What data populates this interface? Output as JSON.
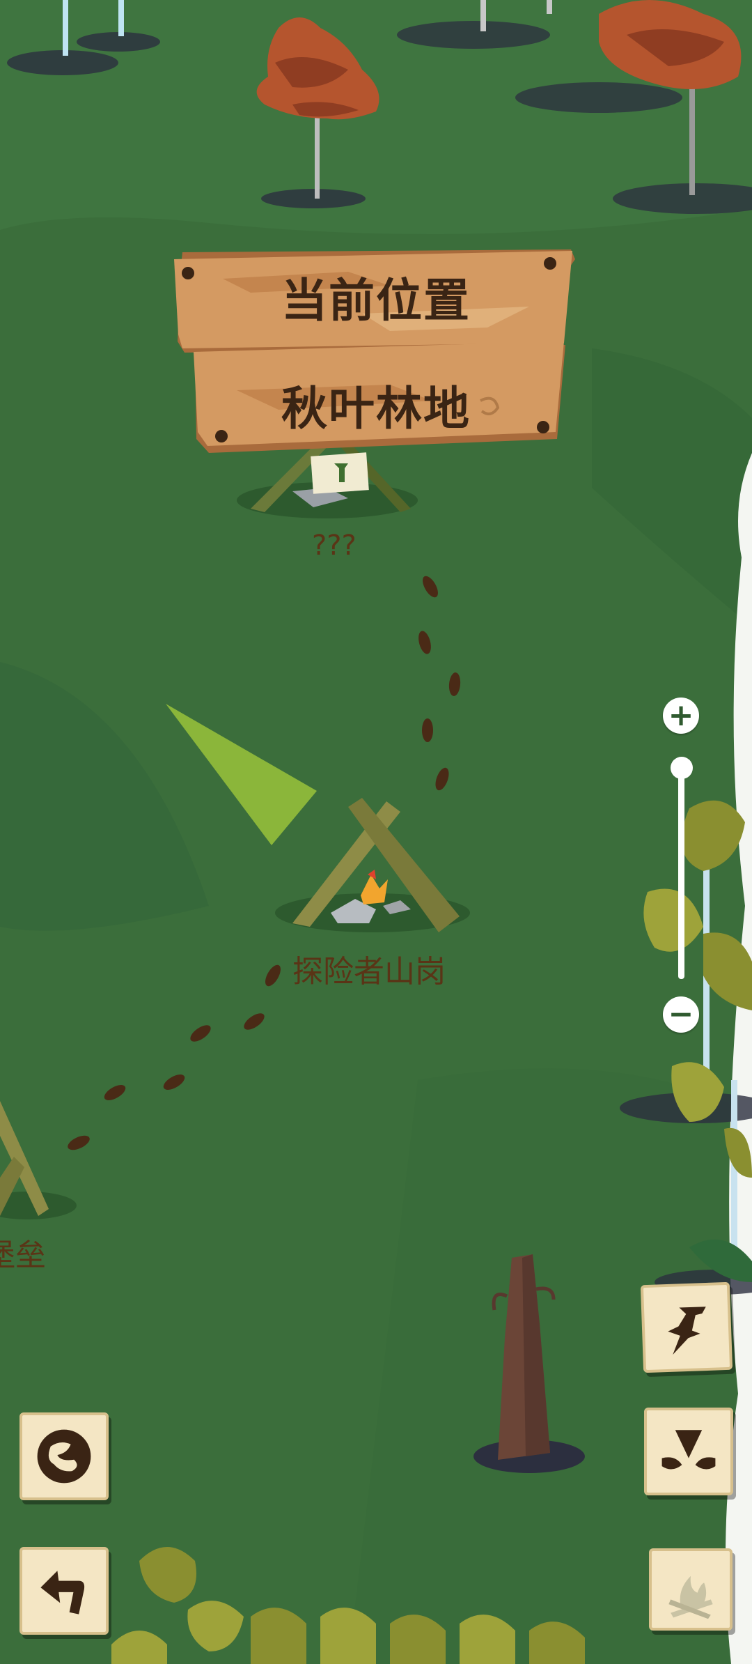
{
  "sign": {
    "line1": "当前位置",
    "line2": "秋叶林地"
  },
  "locations": {
    "unknown": "???",
    "explorer_hill": "探险者山岗",
    "fortress_partial": "堡垒"
  },
  "zoom": {
    "plus_symbol": "+",
    "minus_symbol": "−",
    "level": 1.0
  },
  "buttons": [
    "pin",
    "marker",
    "campfire",
    "world-map",
    "back"
  ],
  "colors": {
    "grass": "#3b6e3b",
    "wood": "#d79a62",
    "label_brown": "#5a3416",
    "button_bg": "#f4e6c4"
  }
}
